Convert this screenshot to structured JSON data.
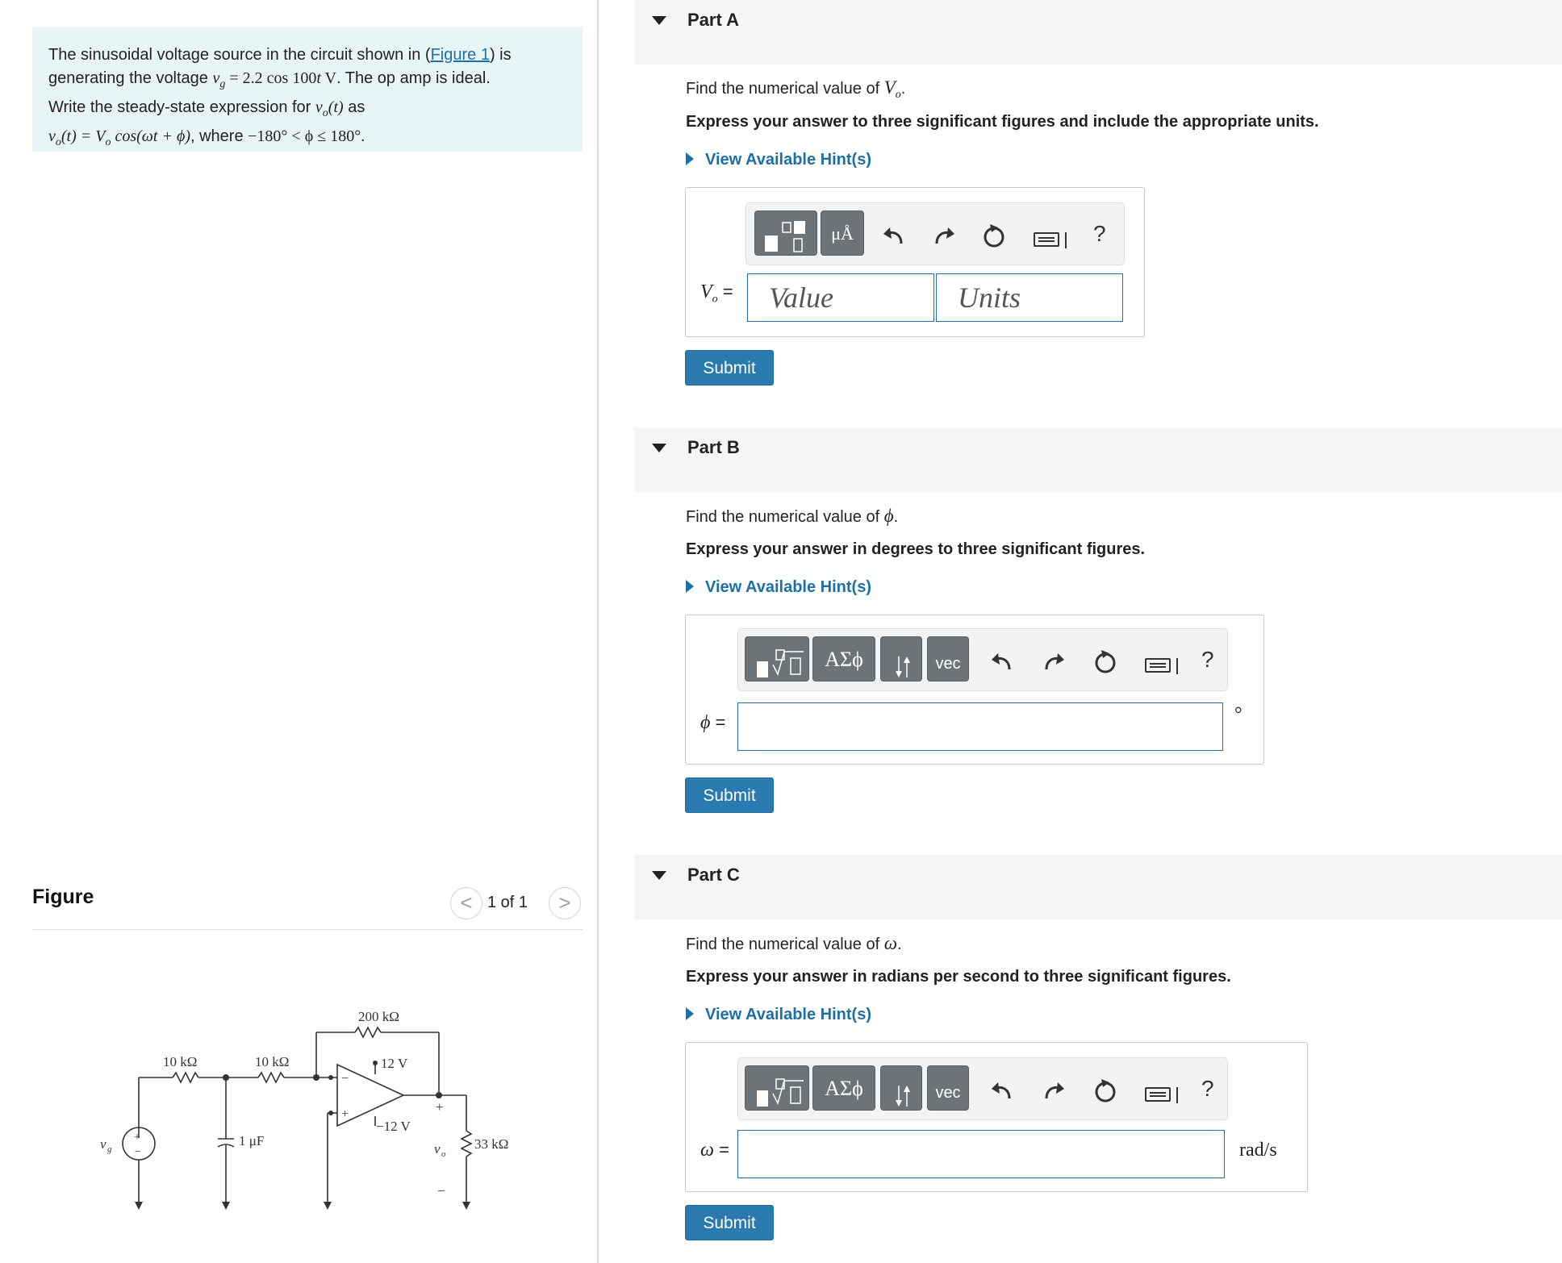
{
  "problem": {
    "line1_pre": "The sinusoidal voltage source in the circuit shown in (",
    "figure_link": "Figure 1",
    "line1_post": ") is",
    "line2_pre": "generating the voltage ",
    "line2_math": "v",
    "line2_sub": "g",
    "line2_eq": " = 2.2 cos 100",
    "line2_t": "t",
    "line2_unit": " V",
    "line2_post": ". The op amp is ideal.",
    "line3_pre": "Write the steady-state expression for ",
    "line3_math": "v",
    "line3_sub": "o",
    "line3_arg": "(t)",
    "line3_post": " as",
    "line4_lhs": "v",
    "line4_lhs_sub": "o",
    "line4_lhs_arg": "(t) = ",
    "line4_V": "V",
    "line4_V_sub": "o",
    "line4_rest": " cos(ωt + ϕ)",
    "line4_where": ", where ",
    "line4_range": "−180° < ϕ ≤ 180°."
  },
  "figure": {
    "title": "Figure",
    "prev": "<",
    "next": ">",
    "count": "1 of 1",
    "labels": {
      "r1": "10 kΩ",
      "r2": "10 kΩ",
      "rf": "200 kΩ",
      "vpos": "12 V",
      "vneg": "−12 V",
      "cap": "1 μF",
      "rl": "33 kΩ",
      "vg": "v",
      "vg_sub": "g",
      "vo": "v",
      "vo_sub": "o",
      "plus": "+",
      "minus": "−",
      "opminus": "−",
      "opplus": "+",
      "src_plus": "+",
      "src_minus": "−"
    }
  },
  "parts": [
    {
      "title": "Part A",
      "question_pre": "Find the numerical value of ",
      "question_var": "V",
      "question_sub": "o",
      "question_post": ".",
      "instruction": "Express your answer to three significant figures and include the appropriate units.",
      "hint": "View Available Hint(s)",
      "var_label": "V",
      "var_sub": "o",
      "var_eq": " =",
      "value_placeholder": "Value",
      "units_placeholder": "Units",
      "tool_units": "μÅ",
      "help": "?",
      "submit": "Submit"
    },
    {
      "title": "Part B",
      "question_pre": "Find the numerical value of ",
      "question_var": "ϕ",
      "question_post": ".",
      "instruction": "Express your answer in degrees to three significant figures.",
      "hint": "View Available Hint(s)",
      "var_label": "ϕ",
      "var_eq": " =",
      "unit": "°",
      "tool_greek": "ΑΣϕ",
      "tool_vec": "vec",
      "help": "?",
      "submit": "Submit"
    },
    {
      "title": "Part C",
      "question_pre": "Find the numerical value of ",
      "question_var": "ω",
      "question_post": ".",
      "instruction": "Express your answer in radians per second to three significant figures.",
      "hint": "View Available Hint(s)",
      "var_label": "ω",
      "var_eq": " =",
      "unit": "rad/s",
      "tool_greek": "ΑΣϕ",
      "tool_vec": "vec",
      "help": "?",
      "submit": "Submit"
    }
  ],
  "icons": {
    "undo": "undo-icon",
    "redo": "redo-icon",
    "reset": "reset-icon",
    "keyboard": "keyboard-icon"
  },
  "colors": {
    "accent": "#2a7ab0",
    "link": "#1d6fa5",
    "problem_bg": "#e8f5f7",
    "tool_button": "#6e7377"
  }
}
